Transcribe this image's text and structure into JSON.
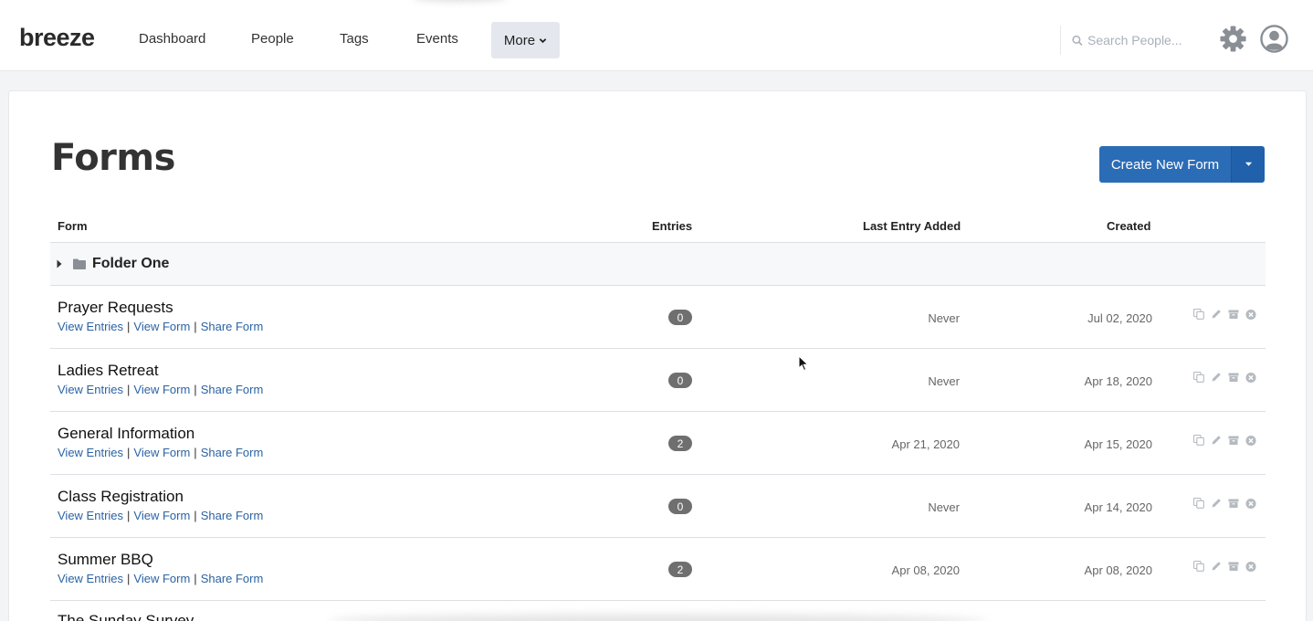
{
  "app": {
    "logo": "breeze"
  },
  "nav": {
    "items": [
      "Dashboard",
      "People",
      "Tags",
      "Events"
    ],
    "more_label": "More"
  },
  "search": {
    "placeholder": "Search People..."
  },
  "icons": {
    "search": "search-icon",
    "settings": "gear-icon",
    "account": "user-avatar-icon",
    "row_actions": [
      "copy-icon",
      "edit-icon",
      "archive-icon",
      "delete-icon"
    ]
  },
  "colors": {
    "primary": "#2b6cb6",
    "link": "#2b63a3",
    "badge": "#6f6f6f"
  },
  "page": {
    "title": "Forms",
    "create_button": "Create New Form"
  },
  "table": {
    "columns": {
      "form": "Form",
      "entries": "Entries",
      "last_entry": "Last Entry Added",
      "created": "Created"
    },
    "folder": {
      "name": "Folder One"
    },
    "link_labels": [
      "View Entries",
      "View Form",
      "Share Form"
    ],
    "rows": [
      {
        "name": "Prayer Requests",
        "entries": "0",
        "last_entry": "Never",
        "created": "Jul 02, 2020"
      },
      {
        "name": "Ladies Retreat",
        "entries": "0",
        "last_entry": "Never",
        "created": "Apr 18, 2020"
      },
      {
        "name": "General Information",
        "entries": "2",
        "last_entry": "Apr 21, 2020",
        "created": "Apr 15, 2020"
      },
      {
        "name": "Class Registration",
        "entries": "0",
        "last_entry": "Never",
        "created": "Apr 14, 2020"
      },
      {
        "name": "Summer BBQ",
        "entries": "2",
        "last_entry": "Apr 08, 2020",
        "created": "Apr 08, 2020"
      }
    ],
    "partial_row_name": "The Sunday Survey"
  }
}
